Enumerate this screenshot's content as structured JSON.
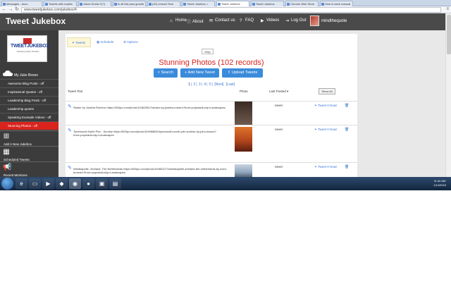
{
  "browser": {
    "tabs": [
      {
        "title": "Messages - Acco"
      },
      {
        "title": "Tweets with replies"
      },
      {
        "title": "Jokes Social Y(?)"
      },
      {
        "title": "Is all this plus growth"
      },
      {
        "title": "(20) unread Tech"
      },
      {
        "title": "Tweet Jukebox ="
      },
      {
        "title": "Tweet Jukebox"
      },
      {
        "title": "Tweet Jukebox"
      },
      {
        "title": "Chrome Web Store"
      },
      {
        "title": "How to save manual"
      }
    ],
    "url": "www.tweetjukebox.com/jukebox/4"
  },
  "header": {
    "brand": "Tweet Jukebox",
    "nav": [
      {
        "label": "Home",
        "icon": "home-icon"
      },
      {
        "label": "About",
        "icon": "info-icon"
      },
      {
        "label": "Contact us",
        "icon": "mail-icon"
      },
      {
        "label": "FAQ",
        "icon": "question-icon"
      },
      {
        "label": "Videos",
        "icon": "video-icon"
      },
      {
        "label": "Log Out",
        "icon": "logout-icon"
      }
    ],
    "user_name": "mindthequote"
  },
  "sidebar": {
    "logo_text": "TWEETJUKEBOX",
    "logo_tagline": "Thinking Inside The Box",
    "section_title": "My Juke Boxes",
    "items": [
      {
        "label": "Awesome Blog Posts - off",
        "active": false
      },
      {
        "label": "Inspirational Quotes - off",
        "active": false
      },
      {
        "label": "Leadership Blog Posts - off",
        "active": false
      },
      {
        "label": "Leadership quotes",
        "active": false
      },
      {
        "label": "Speaking Example Videos - off",
        "active": false
      },
      {
        "label": "Stunning Photos - off",
        "active": true
      }
    ],
    "add_label": "Add A New Jukebox",
    "scheduled_label": "Scheduled Tweets",
    "mentions_label": "Recent Mentions"
  },
  "main": {
    "subtabs": [
      {
        "label": "Tweets",
        "active": true
      },
      {
        "label": "Schedule",
        "active": false
      },
      {
        "label": "Options",
        "active": false
      }
    ],
    "help_label": "Help",
    "heading": "Stunning Photos  (102 records)",
    "buttons": {
      "search": "Search",
      "add_tweet": "+ Add New Tweet",
      "upload": "Upload Tweets"
    },
    "pager": {
      "pages": [
        "1",
        "2",
        "3",
        "4",
        "5"
      ],
      "current": "1",
      "next": "[Next]",
      "last": "[Last]"
    },
    "columns": {
      "text": "Tweet Text",
      "photo": "Photo",
      "last_posted": "Last Posted",
      "show_all": "Show All"
    },
    "rows": [
      {
        "text": "Stoker by Joseba Romero https://500px.com/photo/104615617/stoker-by-joseba-romero?from=popular&only=Landscapes",
        "last_posted": "never",
        "tweet_now": "Tweet It Now!",
        "photo_colors": [
          "#3a2a22",
          "#6d5a4e"
        ]
      },
      {
        "text": "Tynemouth North Pier - Sunrise https://500px.com/photo/104968551/tynemouth-north-pier-sunrise-by-john-lesson?from=popular&only=Landscapes",
        "last_posted": "never",
        "tweet_now": "Tweet It Now!",
        "photo_colors": [
          "#e0732a",
          "#5a1e10"
        ]
      },
      {
        "text": "Westkapelle, Zeeland, The Netherlands https://500px.com/photo/104651271/westkapelle-zeeland-the-netherlands-by-sven-broeckx?from=popular&only=Landscapes",
        "last_posted": "never",
        "tweet_now": "Tweet It Now!",
        "photo_colors": [
          "#8fa6be",
          "#4b5a6a"
        ]
      }
    ]
  },
  "taskbar": {
    "time": "11:42 AM",
    "date": "1/14/2015"
  }
}
